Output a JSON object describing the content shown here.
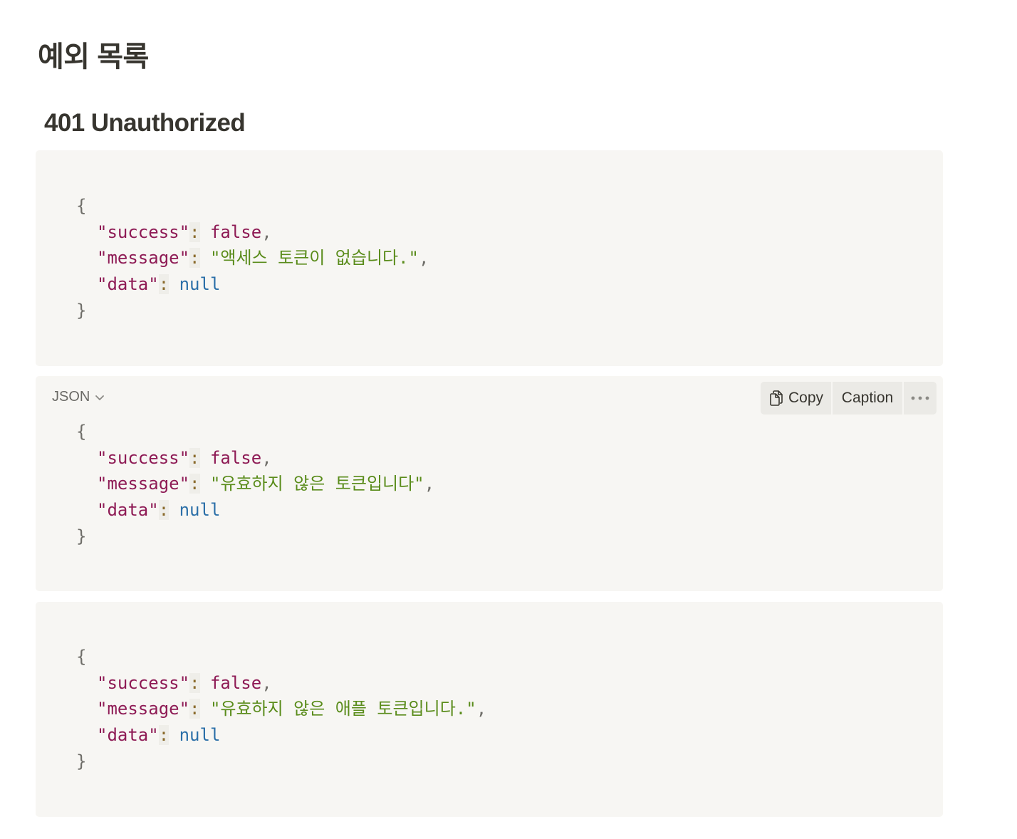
{
  "page": {
    "title": "예외 목록",
    "section_heading": "401 Unauthorized"
  },
  "code_toolbar": {
    "language": "JSON",
    "copy_label": "Copy",
    "caption_label": "Caption",
    "more_icon": "ellipsis-icon",
    "copy_icon": "copy-icon",
    "language_icon": "chevron-down-icon"
  },
  "code_blocks": [
    {
      "open_brace": "{",
      "success_key": "\"success\"",
      "success_value": "false",
      "message_key": "\"message\"",
      "message_value": "\"액세스 토큰이 없습니다.\"",
      "data_key": "\"data\"",
      "data_value": "null",
      "close_brace": "}"
    },
    {
      "open_brace": "{",
      "success_key": "\"success\"",
      "success_value": "false",
      "message_key": "\"message\"",
      "message_value": "\"유효하지 않은 토큰입니다\"",
      "data_key": "\"data\"",
      "data_value": "null",
      "close_brace": "}"
    },
    {
      "open_brace": "{",
      "success_key": "\"success\"",
      "success_value": "false",
      "message_key": "\"message\"",
      "message_value": "\"유효하지 않은 애플 토큰입니다.\"",
      "data_key": "\"data\"",
      "data_value": "null",
      "close_brace": "}"
    }
  ],
  "syntax": {
    "colon": ":",
    "comma": ","
  }
}
